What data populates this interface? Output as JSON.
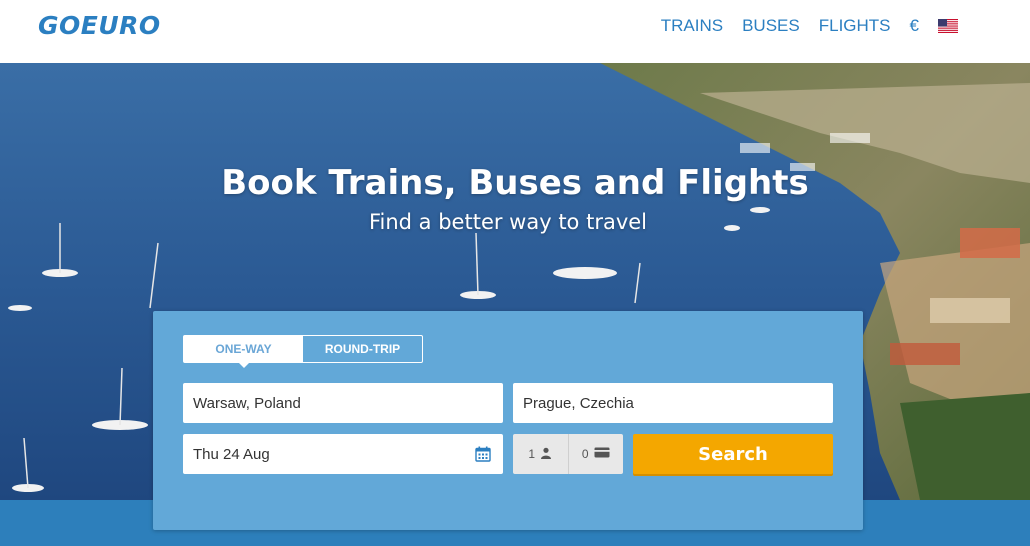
{
  "header": {
    "logo": "GOEURO",
    "nav": {
      "trains": "TRAINS",
      "buses": "BUSES",
      "flights": "FLIGHTS",
      "currency": "€"
    }
  },
  "hero": {
    "title": "Book Trains, Buses and Flights",
    "subtitle": "Find a better way to travel"
  },
  "search": {
    "trip_types": [
      "ONE-WAY",
      "ROUND-TRIP"
    ],
    "selected_trip_type": "ONE-WAY",
    "from_value": "Warsaw, Poland",
    "to_value": "Prague, Czechia",
    "date_value": "Thu 24 Aug",
    "adults": "1",
    "children_or_cards": "0",
    "button_label": "Search"
  },
  "colors": {
    "brand": "#2b7fc1",
    "panel": "#62a8d8",
    "search_button": "#f4a700"
  },
  "icons": [
    "calendar-icon",
    "person-icon",
    "card-icon",
    "us-flag-icon"
  ]
}
